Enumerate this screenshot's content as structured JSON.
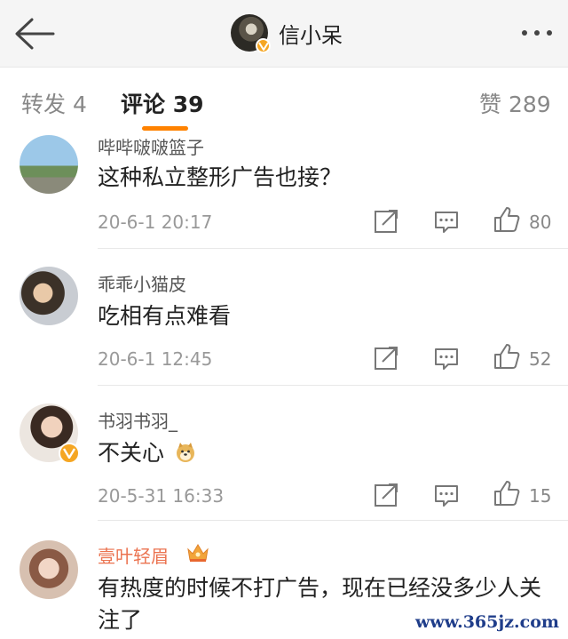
{
  "header": {
    "title": "信小呆",
    "back_icon": "arrow-left-icon",
    "more_icon": "more-dots-icon",
    "badge_color": "#f5a623"
  },
  "tabs": {
    "repost": "转发 4",
    "comments": "评论 39",
    "likes": "赞 289",
    "accent_color": "#ff8200"
  },
  "comments": [
    {
      "user": "哔哔啵啵篮子",
      "text": "这种私立整形广告也接？",
      "time": "20-6-1 20:17",
      "likes": "80"
    },
    {
      "user": "乖乖小猫皮",
      "text": "吃相有点难看",
      "time": "20-6-1 12:45",
      "likes": "52"
    },
    {
      "user": "书羽书羽_",
      "text": "不关心",
      "time": "20-5-31 16:33",
      "likes": "15",
      "verified": true,
      "emoji": "doge-emoji"
    },
    {
      "user": "壹叶轻眉",
      "text": "有热度的时候不打广告，现在已经没多少人关注了",
      "vip": true,
      "vip_icon": "crown-icon"
    }
  ],
  "watermark": "www.365jz.com"
}
